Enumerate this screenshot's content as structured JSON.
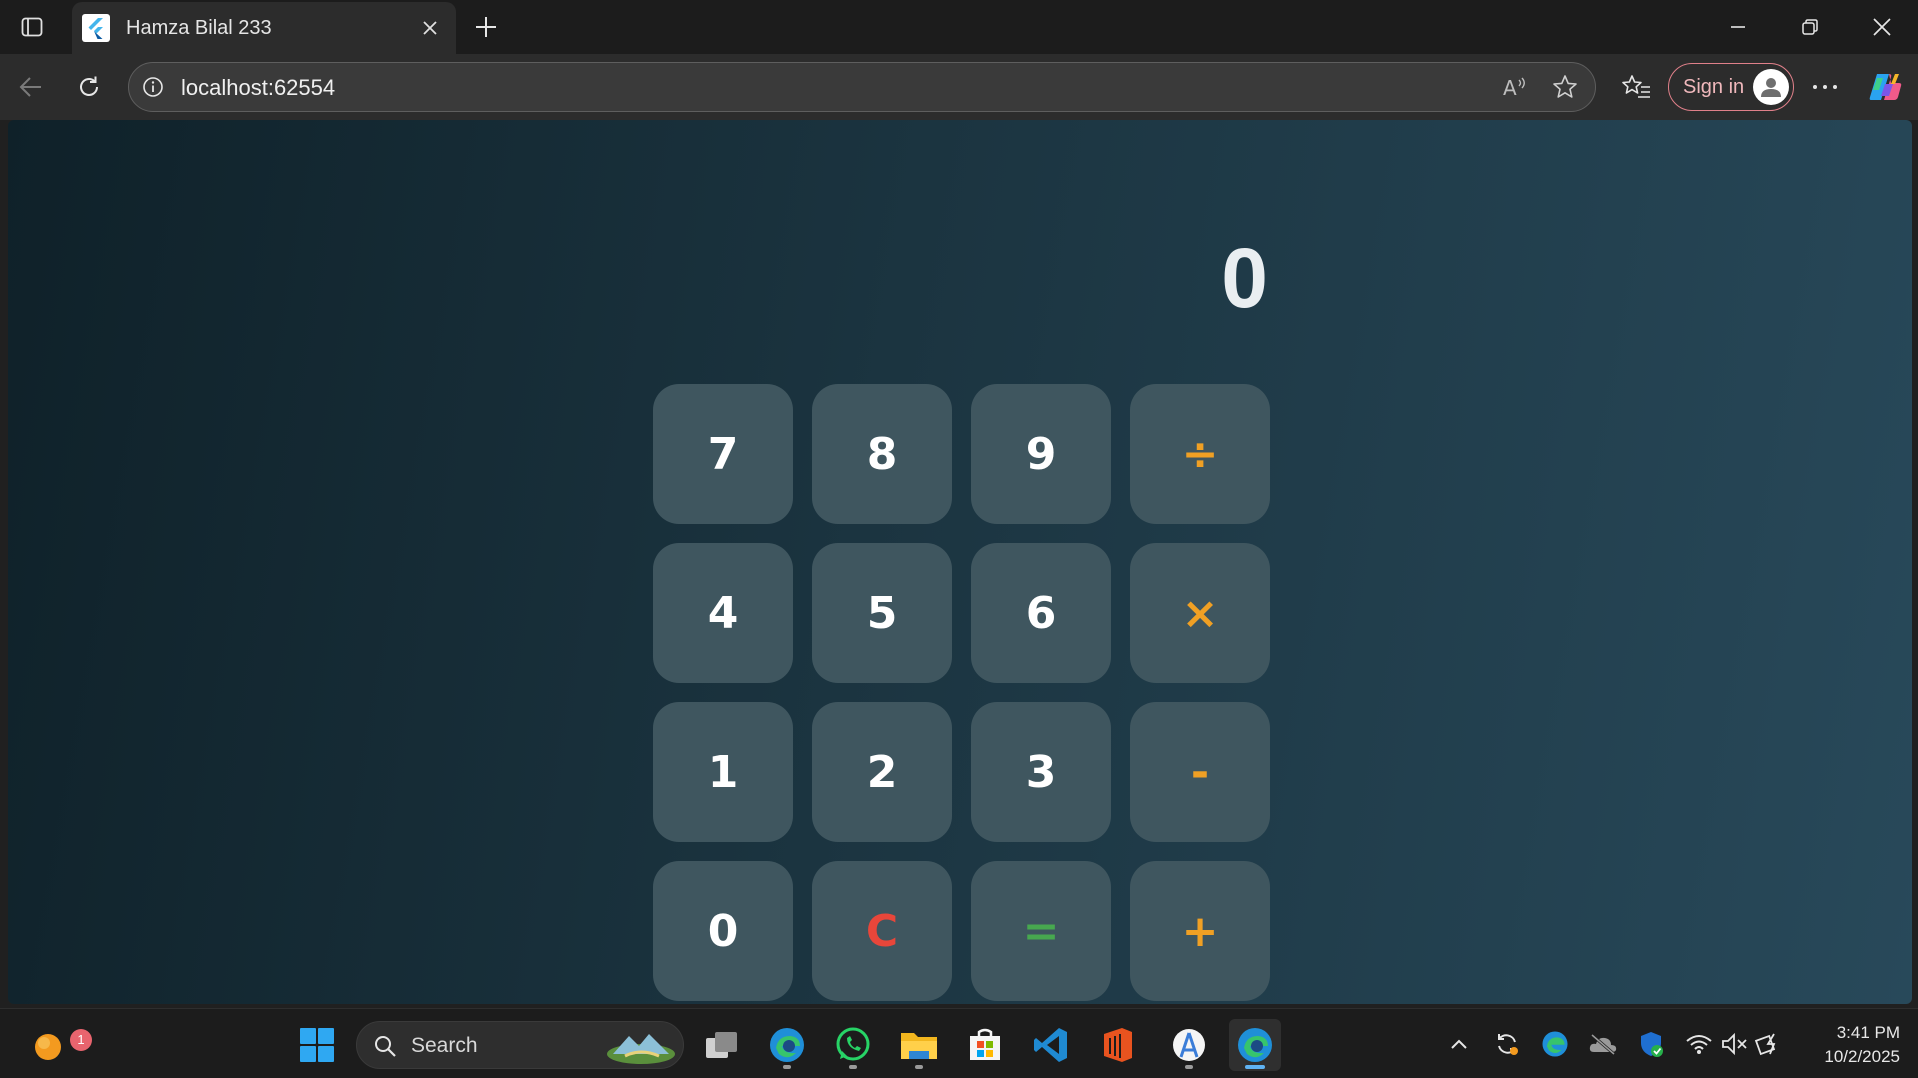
{
  "browser": {
    "tab_title": "Hamza Bilal 233",
    "url": "localhost:62554",
    "sign_in_label": "Sign in"
  },
  "calculator": {
    "display": "0",
    "keys": [
      {
        "label": "7",
        "kind": "digit"
      },
      {
        "label": "8",
        "kind": "digit"
      },
      {
        "label": "9",
        "kind": "digit"
      },
      {
        "label": "÷",
        "kind": "op"
      },
      {
        "label": "4",
        "kind": "digit"
      },
      {
        "label": "5",
        "kind": "digit"
      },
      {
        "label": "6",
        "kind": "digit"
      },
      {
        "label": "×",
        "kind": "op"
      },
      {
        "label": "1",
        "kind": "digit"
      },
      {
        "label": "2",
        "kind": "digit"
      },
      {
        "label": "3",
        "kind": "digit"
      },
      {
        "label": "-",
        "kind": "op"
      },
      {
        "label": "0",
        "kind": "digit"
      },
      {
        "label": "C",
        "kind": "clear"
      },
      {
        "label": "=",
        "kind": "eq"
      },
      {
        "label": "+",
        "kind": "op"
      }
    ],
    "colors": {
      "operator": "#f0a024",
      "clear": "#e8463a",
      "equals": "#47a84f",
      "key_bg": "#3f565f"
    }
  },
  "taskbar": {
    "search_label": "Search",
    "notification_count": "1",
    "time": "3:41 PM",
    "date": "10/2/2025"
  }
}
